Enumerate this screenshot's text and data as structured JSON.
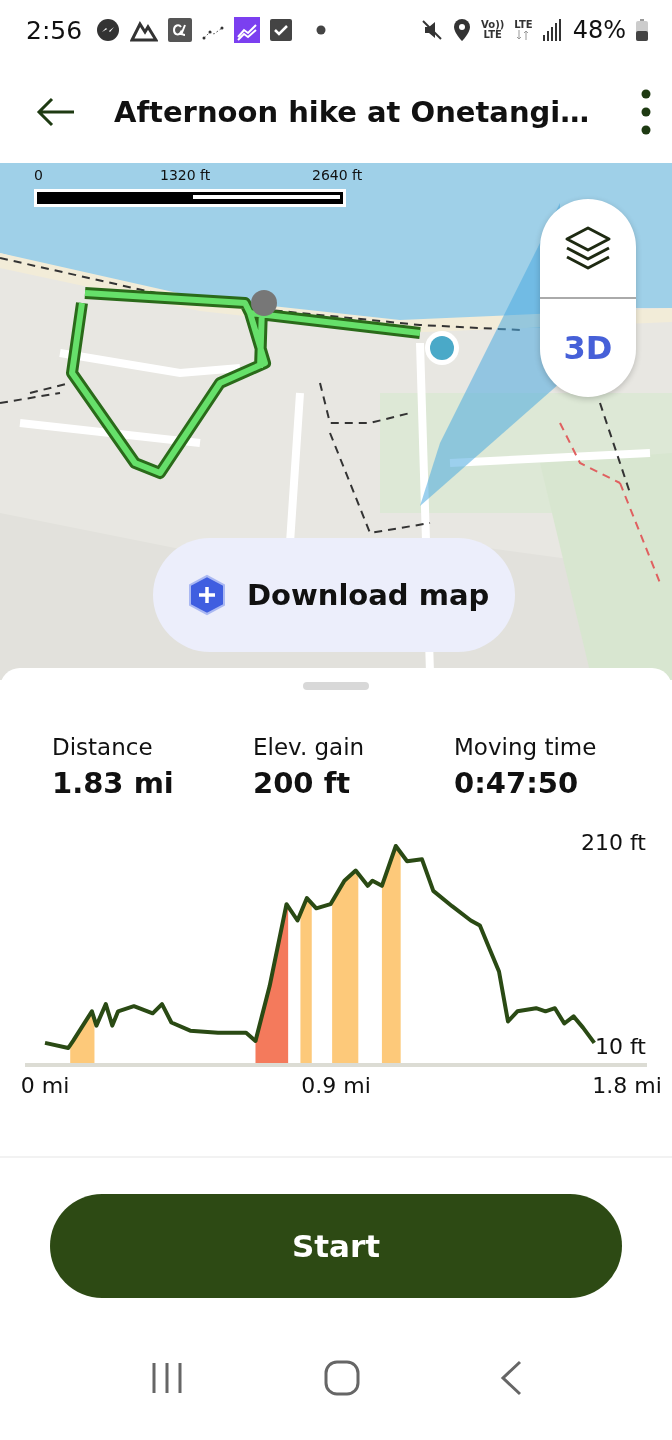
{
  "status_bar": {
    "time": "2:56",
    "volte_top": "Vo))",
    "volte_bottom": "LTE",
    "network": "LTE",
    "battery": "48%"
  },
  "app_bar": {
    "title": "Afternoon hike at Onetangi…"
  },
  "map": {
    "kind": "picture",
    "scale_labels": [
      "0",
      "1320 ft",
      "2640 ft"
    ],
    "mode_button": "3D",
    "download_button": "Download map"
  },
  "stats": [
    {
      "label": "Distance",
      "value": "1.83 mi"
    },
    {
      "label": "Elev. gain",
      "value": "200 ft"
    },
    {
      "label": "Moving time",
      "value": "0:47:50"
    }
  ],
  "elevation": {
    "chart_data": {
      "type": "line",
      "xlim": [
        0,
        1.8
      ],
      "ylim": [
        10,
        210
      ],
      "xticks": [
        {
          "value": 0,
          "label": "0 mi"
        },
        {
          "value": 0.9,
          "label": "0.9 mi"
        },
        {
          "value": 1.8,
          "label": "1.8 mi"
        }
      ],
      "yticks": [
        {
          "value": 10,
          "label": "10 ft"
        },
        {
          "value": 210,
          "label": "210 ft"
        }
      ],
      "series": [
        {
          "color": "#2a4a14",
          "x": [
            0,
            0.072,
            0.087,
            0.145,
            0.159,
            0.188,
            0.208,
            0.226,
            0.275,
            0.333,
            0.362,
            0.391,
            0.449,
            0.535,
            0.622,
            0.651,
            0.695,
            0.747,
            0.781,
            0.81,
            0.839,
            0.883,
            0.926,
            0.961,
            0.998,
            1.013,
            1.042,
            1.085,
            1.12,
            1.166,
            1.201,
            1.259,
            1.317,
            1.345,
            1.375,
            1.404,
            1.432,
            1.461,
            1.519,
            1.548,
            1.577,
            1.606,
            1.635,
            1.664,
            1.699
          ],
          "values": [
            15,
            10,
            17,
            46,
            32,
            53,
            32,
            46,
            51,
            44,
            53,
            35,
            27,
            25,
            25,
            17,
            71,
            151,
            135,
            157,
            147,
            151,
            174,
            184,
            169,
            174,
            169,
            208,
            193,
            195,
            164,
            149,
            135,
            130,
            107,
            85,
            36,
            46,
            49,
            46,
            49,
            34,
            41,
            30,
            15
          ]
        }
      ],
      "bands": [
        {
          "axis": "x",
          "from": 0.078,
          "to": 0.153,
          "color": "#fdc97a"
        },
        {
          "axis": "x",
          "from": 0.651,
          "to": 0.752,
          "color": "#f47a5c"
        },
        {
          "axis": "x",
          "from": 0.79,
          "to": 0.825,
          "color": "#fdc97a"
        },
        {
          "axis": "x",
          "from": 0.888,
          "to": 0.969,
          "color": "#fdc97a"
        },
        {
          "axis": "x",
          "from": 1.042,
          "to": 1.1,
          "color": "#fdc97a"
        }
      ]
    }
  },
  "start_button": "Start"
}
